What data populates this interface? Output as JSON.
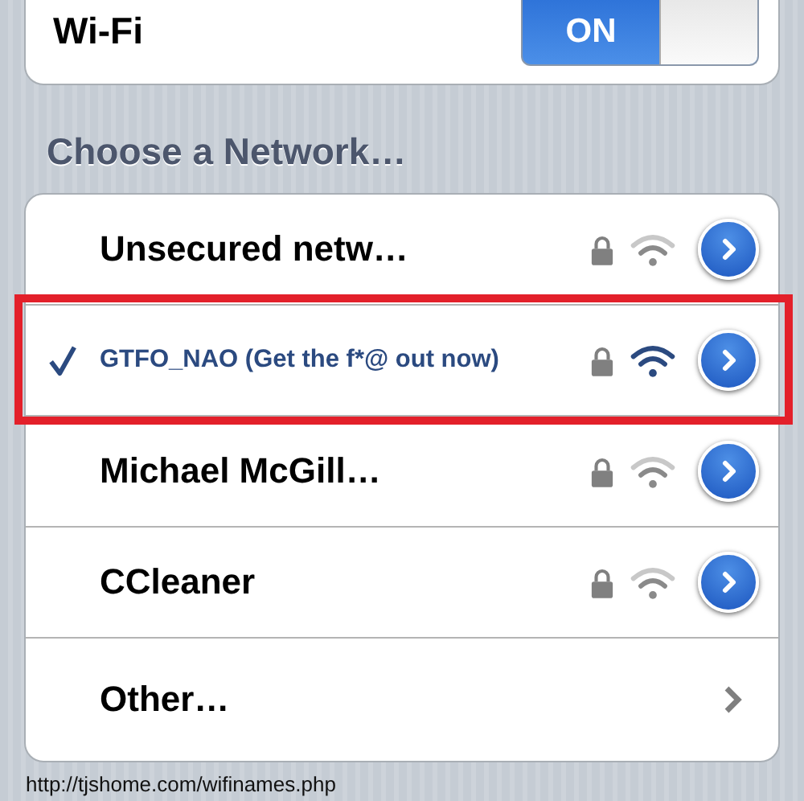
{
  "wifi": {
    "label": "Wi-Fi",
    "on": true,
    "switch_text": "ON"
  },
  "section_title": "Choose a Network…",
  "networks": [
    {
      "name": "Unsecured netw…",
      "selected": false,
      "highlighted": false,
      "locked": true
    },
    {
      "name": "GTFO_NAO (Get the f*@ out now)",
      "selected": true,
      "highlighted": true,
      "locked": true
    },
    {
      "name": "Michael McGill…",
      "selected": false,
      "highlighted": false,
      "locked": true
    },
    {
      "name": "CCleaner",
      "selected": false,
      "highlighted": false,
      "locked": true
    }
  ],
  "other": {
    "label": "Other…"
  },
  "caption": "http://tjshome.com/wifinames.php"
}
